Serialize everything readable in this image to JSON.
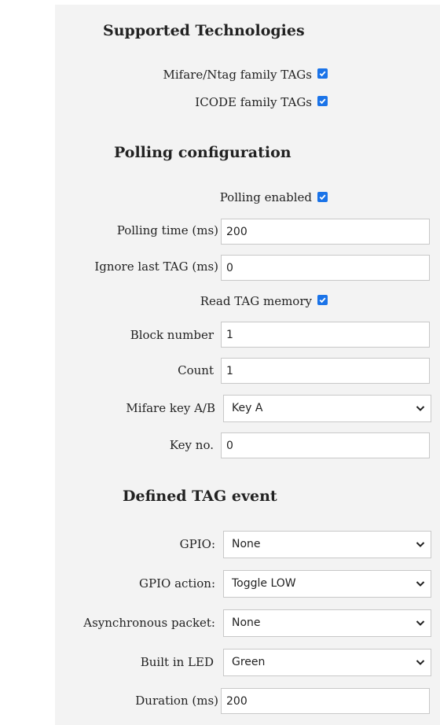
{
  "sections": {
    "supported": "Supported Technologies",
    "polling": "Polling configuration",
    "event": "Defined TAG event"
  },
  "supported": {
    "mifare_label": "Mifare/Ntag family TAGs",
    "mifare_checked": true,
    "icode_label": "ICODE family TAGs",
    "icode_checked": true
  },
  "polling": {
    "enabled_label": "Polling enabled",
    "enabled_checked": true,
    "time_label": "Polling time (ms)",
    "time_value": "200",
    "ignore_label": "Ignore last TAG (ms)",
    "ignore_value": "0",
    "read_memory_label": "Read TAG memory",
    "read_memory_checked": true,
    "block_label": "Block number",
    "block_value": "1",
    "count_label": "Count",
    "count_value": "1",
    "key_ab_label": "Mifare key A/B",
    "key_ab_value": "Key A",
    "key_no_label": "Key no.",
    "key_no_value": "0"
  },
  "event": {
    "gpio_label": "GPIO:",
    "gpio_value": "None",
    "gpio_action_label": "GPIO action:",
    "gpio_action_value": "Toggle LOW",
    "async_label": "Asynchronous packet:",
    "async_value": "None",
    "led_label": "Built in LED",
    "led_value": "Green",
    "duration_label": "Duration (ms)",
    "duration_value": "200"
  },
  "colors": {
    "checkbox": "#1a73e8",
    "panel_bg": "#f3f3f3"
  }
}
